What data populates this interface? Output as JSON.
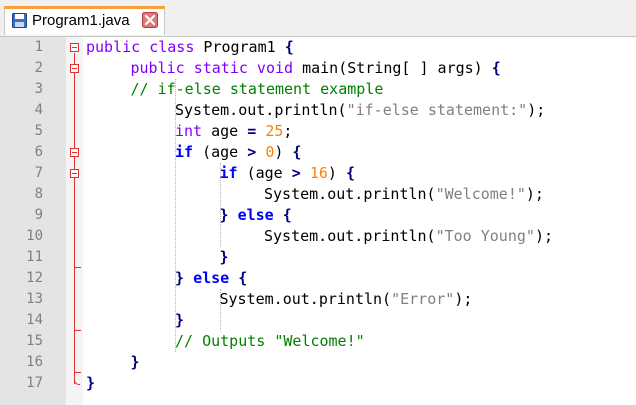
{
  "tab": {
    "title": "Program1.java",
    "icon": "save-icon",
    "close_icon": "close-icon",
    "accent_color": "#f8a040"
  },
  "colors": {
    "keyword": "#8000ff",
    "flow_keyword": "#0000ff",
    "comment": "#008000",
    "string": "#808080",
    "number": "#ff8000",
    "operator": "#000080",
    "fold_marker": "#e03030",
    "line_number": "#808080"
  },
  "line_numbers": [
    "1",
    "2",
    "3",
    "4",
    "5",
    "6",
    "7",
    "8",
    "9",
    "10",
    "11",
    "12",
    "13",
    "14",
    "15",
    "16",
    "17"
  ],
  "code": [
    {
      "indent": 0,
      "tokens": [
        {
          "c": "kw",
          "t": "public class"
        },
        {
          "c": "",
          "t": " Program1 "
        },
        {
          "c": "op",
          "t": "{"
        }
      ]
    },
    {
      "indent": 1,
      "tokens": [
        {
          "c": "kw",
          "t": "public static void"
        },
        {
          "c": "",
          "t": " main(String[ ] args) "
        },
        {
          "c": "op",
          "t": "{"
        }
      ]
    },
    {
      "indent": 1,
      "tokens": [
        {
          "c": "cm",
          "t": "// if-else statement example"
        }
      ]
    },
    {
      "indent": 2,
      "tokens": [
        {
          "c": "",
          "t": "System.out.println("
        },
        {
          "c": "st",
          "t": "\"if-else statement:\""
        },
        {
          "c": "",
          "t": ");"
        }
      ]
    },
    {
      "indent": 2,
      "tokens": [
        {
          "c": "kw",
          "t": "int"
        },
        {
          "c": "",
          "t": " age "
        },
        {
          "c": "op",
          "t": "="
        },
        {
          "c": "",
          "t": " "
        },
        {
          "c": "nu",
          "t": "25"
        },
        {
          "c": "",
          "t": ";"
        }
      ]
    },
    {
      "indent": 2,
      "tokens": [
        {
          "c": "fl",
          "t": "if"
        },
        {
          "c": "",
          "t": " (age "
        },
        {
          "c": "op",
          "t": ">"
        },
        {
          "c": "",
          "t": " "
        },
        {
          "c": "nu",
          "t": "0"
        },
        {
          "c": "",
          "t": ") "
        },
        {
          "c": "op",
          "t": "{"
        }
      ]
    },
    {
      "indent": 3,
      "tokens": [
        {
          "c": "fl",
          "t": "if"
        },
        {
          "c": "",
          "t": " (age "
        },
        {
          "c": "op",
          "t": ">"
        },
        {
          "c": "",
          "t": " "
        },
        {
          "c": "nu",
          "t": "16"
        },
        {
          "c": "",
          "t": ") "
        },
        {
          "c": "op",
          "t": "{"
        }
      ]
    },
    {
      "indent": 4,
      "tokens": [
        {
          "c": "",
          "t": "System.out.println("
        },
        {
          "c": "st",
          "t": "\"Welcome!\""
        },
        {
          "c": "",
          "t": ");"
        }
      ]
    },
    {
      "indent": 3,
      "tokens": [
        {
          "c": "op",
          "t": "}"
        },
        {
          "c": "",
          "t": " "
        },
        {
          "c": "fl",
          "t": "else"
        },
        {
          "c": "",
          "t": " "
        },
        {
          "c": "op",
          "t": "{"
        }
      ]
    },
    {
      "indent": 4,
      "tokens": [
        {
          "c": "",
          "t": "System.out.println("
        },
        {
          "c": "st",
          "t": "\"Too Young\""
        },
        {
          "c": "",
          "t": ");"
        }
      ]
    },
    {
      "indent": 3,
      "tokens": [
        {
          "c": "op",
          "t": "}"
        }
      ]
    },
    {
      "indent": 2,
      "tokens": [
        {
          "c": "op",
          "t": "}"
        },
        {
          "c": "",
          "t": " "
        },
        {
          "c": "fl",
          "t": "else"
        },
        {
          "c": "",
          "t": " "
        },
        {
          "c": "op",
          "t": "{"
        }
      ]
    },
    {
      "indent": 3,
      "tokens": [
        {
          "c": "",
          "t": "System.out.println("
        },
        {
          "c": "st",
          "t": "\"Error\""
        },
        {
          "c": "",
          "t": ");"
        }
      ]
    },
    {
      "indent": 2,
      "tokens": [
        {
          "c": "op",
          "t": "}"
        }
      ]
    },
    {
      "indent": 2,
      "tokens": [
        {
          "c": "cm",
          "t": "// Outputs \"Welcome!\""
        }
      ]
    },
    {
      "indent": 1,
      "tokens": [
        {
          "c": "op",
          "t": "}"
        }
      ]
    },
    {
      "indent": 0,
      "tokens": [
        {
          "c": "op",
          "t": "}"
        }
      ]
    }
  ]
}
